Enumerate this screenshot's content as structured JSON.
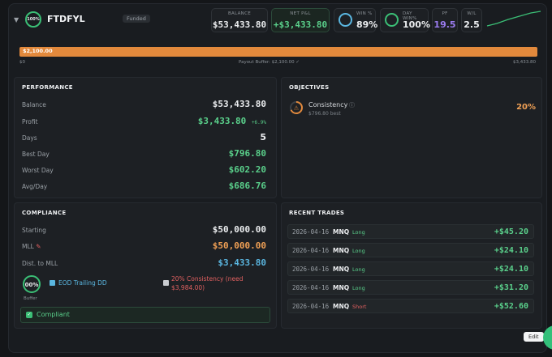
{
  "header": {
    "account_badge": "100%",
    "account_name": "FTDFYL",
    "status_tag": "Funded",
    "stats": {
      "balance_label": "BALANCE",
      "balance_value": "$53,433.80",
      "netpnl_label": "NET P&L",
      "netpnl_value": "+$3,433.80",
      "win_label": "WIN %",
      "win_value": "89%",
      "daywin_label": "DAY WIN%",
      "daywin_value": "100%",
      "pf_label": "PF",
      "pf_value": "19.5",
      "wl_label": "W/L",
      "wl_value": "2.5"
    }
  },
  "progress": {
    "fill_label": "$2,100.00",
    "fill_fraction": 1.0,
    "min_label": "$0",
    "mid_label": "Payout Buffer: $2,100.00 ✓",
    "max_label": "$3,433.80"
  },
  "performance": {
    "title": "PERFORMANCE",
    "balance_label": "Balance",
    "balance_value": "$53,433.80",
    "profit_label": "Profit",
    "profit_value": "$3,433.80",
    "profit_pct": "+6.9%",
    "days_label": "Days",
    "days_value": "5",
    "best_label": "Best Day",
    "best_value": "$796.80",
    "worst_label": "Worst Day",
    "worst_value": "$602.20",
    "avg_label": "Avg/Day",
    "avg_value": "$686.76"
  },
  "objectives": {
    "title": "OBJECTIVES",
    "name": "Consistency",
    "sub": "$796.80 best",
    "value": "20%"
  },
  "compliance": {
    "title": "COMPLIANCE",
    "starting_label": "Starting",
    "starting_value": "$50,000.00",
    "mll_label": "MLL",
    "mll_value": "$50,000.00",
    "dist_label": "Dist. to MLL",
    "dist_value": "$3,433.80",
    "buffer_pct": "00%",
    "buffer_label": "Buffer",
    "rule1": "EOD Trailing DD",
    "rule2": "20% Consistency (need $3,984.00)",
    "status": "Compliant"
  },
  "recent_trades": {
    "title": "RECENT TRADES",
    "rows": [
      {
        "date": "2026-04-16",
        "symbol": "MNQ",
        "side": "Long",
        "pnl": "+$45.20"
      },
      {
        "date": "2026-04-16",
        "symbol": "MNQ",
        "side": "Long",
        "pnl": "+$24.10"
      },
      {
        "date": "2026-04-16",
        "symbol": "MNQ",
        "side": "Long",
        "pnl": "+$24.10"
      },
      {
        "date": "2026-04-16",
        "symbol": "MNQ",
        "side": "Long",
        "pnl": "+$31.20"
      },
      {
        "date": "2026-04-16",
        "symbol": "MNQ",
        "side": "Short",
        "pnl": "+$52.60"
      }
    ]
  },
  "footer": {
    "edit_label": "Edit"
  },
  "colors": {
    "accent_green": "#5ad08b",
    "accent_orange": "#e2893c",
    "accent_blue": "#5ab6e0",
    "short_red": "#e06060"
  }
}
